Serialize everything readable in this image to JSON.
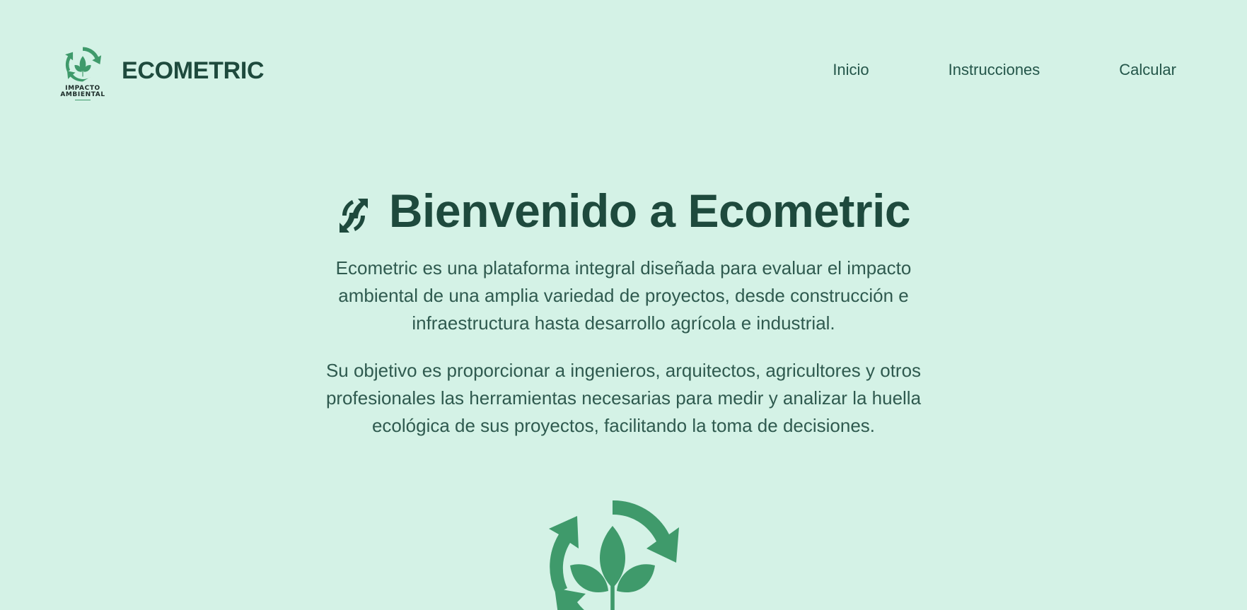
{
  "header": {
    "logo_caption_line1": "IMPACTO",
    "logo_caption_line2": "AMBIENTAL",
    "brand_name": "ECOMETRIC",
    "nav": [
      {
        "label": "Inicio"
      },
      {
        "label": "Instrucciones"
      },
      {
        "label": "Calcular"
      }
    ]
  },
  "hero": {
    "title": "Bienvenido a Ecometric",
    "title_icon": "recycle-arrows-icon",
    "paragraph_1": "Ecometric es una plataforma integral diseñada para evaluar el impacto ambiental de una amplia variedad de proyectos, desde construcción e infraestructura hasta desarrollo agrícola e industrial.",
    "paragraph_2": "Su objetivo es proporcionar a ingenieros, arquitectos, agricultores y otros profesionales las herramientas necesarias para medir y analizar la huella ecológica de sus proyectos, facilitando la toma de decisiones."
  },
  "colors": {
    "background": "#d4f2e6",
    "brand_dark": "#1e4a3d",
    "text": "#2f5a4f",
    "logo_green": "#3f9a6b"
  },
  "icons": {
    "header_logo": "leaf-recycle-logo-icon",
    "hero_logo": "leaf-recycle-logo-icon"
  }
}
